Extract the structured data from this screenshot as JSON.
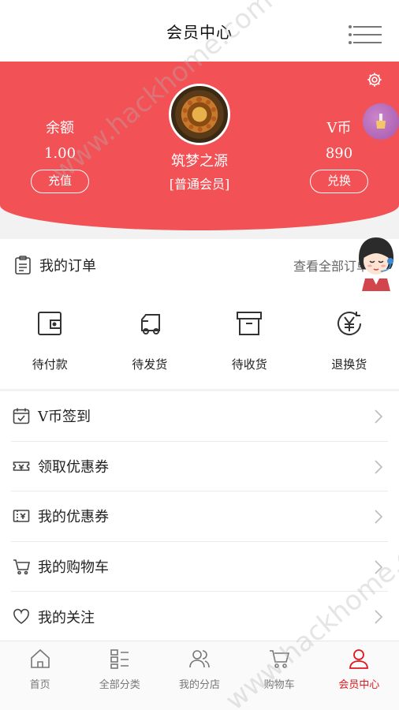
{
  "header": {
    "title": "会员中心",
    "menu_icon": "menu-icon"
  },
  "member": {
    "balance_label": "余额",
    "balance_value": "1.00",
    "recharge_label": "充值",
    "vcoin_label": "V币",
    "vcoin_value": "890",
    "exchange_label": "兑换",
    "username": "筑梦之源",
    "level": "[普通会员]"
  },
  "orders": {
    "title": "我的订单",
    "view_all": "查看全部订单",
    "items": [
      {
        "label": "待付款",
        "icon": "wallet-icon"
      },
      {
        "label": "待发货",
        "icon": "truck-icon"
      },
      {
        "label": "待收货",
        "icon": "box-icon"
      },
      {
        "label": "退换货",
        "icon": "yen-exchange-icon"
      }
    ]
  },
  "menu": [
    {
      "label": "V币签到",
      "icon": "calendar-check-icon"
    },
    {
      "label": "领取优惠券",
      "icon": "coupon-icon"
    },
    {
      "label": "我的优惠券",
      "icon": "ticket-icon"
    },
    {
      "label": "我的购物车",
      "icon": "cart-icon"
    },
    {
      "label": "我的关注",
      "icon": "heart-icon"
    }
  ],
  "tabs": [
    {
      "label": "首页",
      "icon": "home-icon"
    },
    {
      "label": "全部分类",
      "icon": "category-icon"
    },
    {
      "label": "我的分店",
      "icon": "users-icon"
    },
    {
      "label": "购物车",
      "icon": "cart-icon"
    },
    {
      "label": "会员中心",
      "icon": "user-icon",
      "active": true
    }
  ],
  "watermark": "www.hackhome.com",
  "colors": {
    "brand_red": "#f25156",
    "active_tab": "#e0161e"
  }
}
